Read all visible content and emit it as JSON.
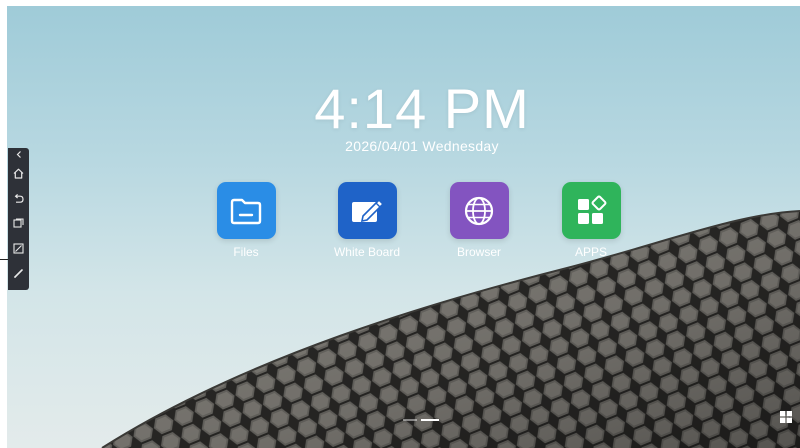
{
  "clock": {
    "time": "4:14 PM",
    "date": "2026/04/01  Wednesday"
  },
  "apps": [
    {
      "label": "Files",
      "icon": "folder-icon",
      "color": "#2a8de6"
    },
    {
      "label": "White Board",
      "icon": "whiteboard-icon",
      "color": "#1f63c8"
    },
    {
      "label": "Browser",
      "icon": "globe-icon",
      "color": "#8354c0"
    },
    {
      "label": "APPS",
      "icon": "apps-grid-icon",
      "color": "#2fb45b"
    }
  ],
  "sidebar": {
    "items": [
      {
        "icon": "collapse-chevron-icon"
      },
      {
        "icon": "home-icon"
      },
      {
        "icon": "back-icon"
      },
      {
        "icon": "windows-icon"
      },
      {
        "icon": "screenshot-icon"
      },
      {
        "icon": "pen-icon"
      }
    ]
  },
  "page_indicator": {
    "pages": 2,
    "current": 2
  },
  "taskbar": {
    "start_icon": "windows-logo-icon"
  }
}
